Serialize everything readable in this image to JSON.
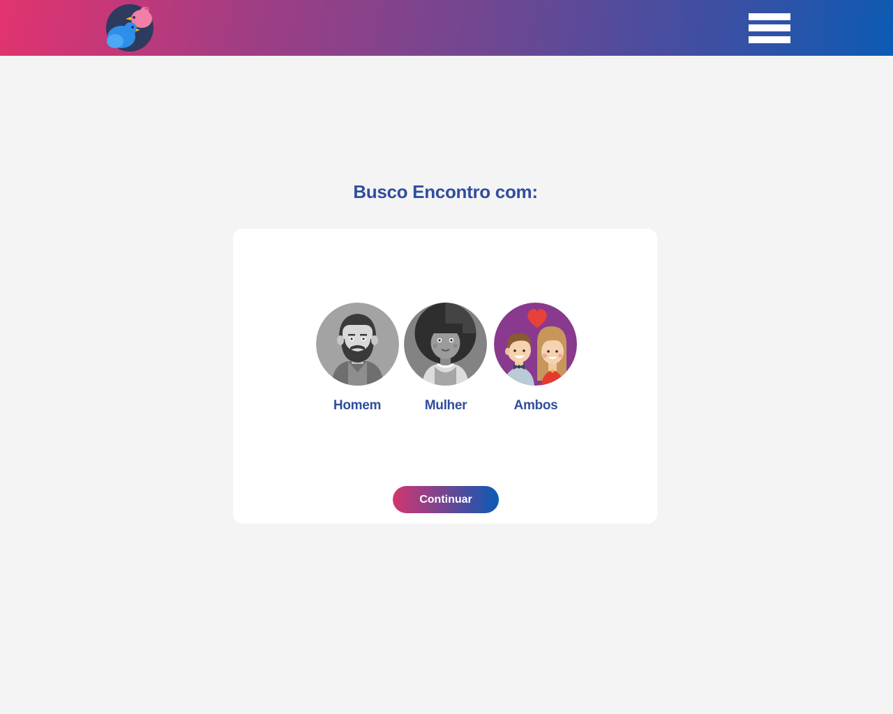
{
  "header": {
    "logo_icon": "two-birds-logo-icon",
    "menu_icon": "hamburger-menu-icon",
    "gradient_start": "#e2336f",
    "gradient_end": "#0c5bb4"
  },
  "main": {
    "title": "Busco Encontro com:",
    "options": [
      {
        "label": "Homem",
        "icon": "man-avatar-icon"
      },
      {
        "label": "Mulher",
        "icon": "woman-avatar-icon"
      },
      {
        "label": "Ambos",
        "icon": "couple-avatar-icon"
      }
    ],
    "continue_label": "Continuar"
  },
  "colors": {
    "accent_text": "#2f4e9d",
    "page_background": "#f4f4f4",
    "card_background": "#ffffff",
    "ambos_background": "#8a3a8e"
  }
}
